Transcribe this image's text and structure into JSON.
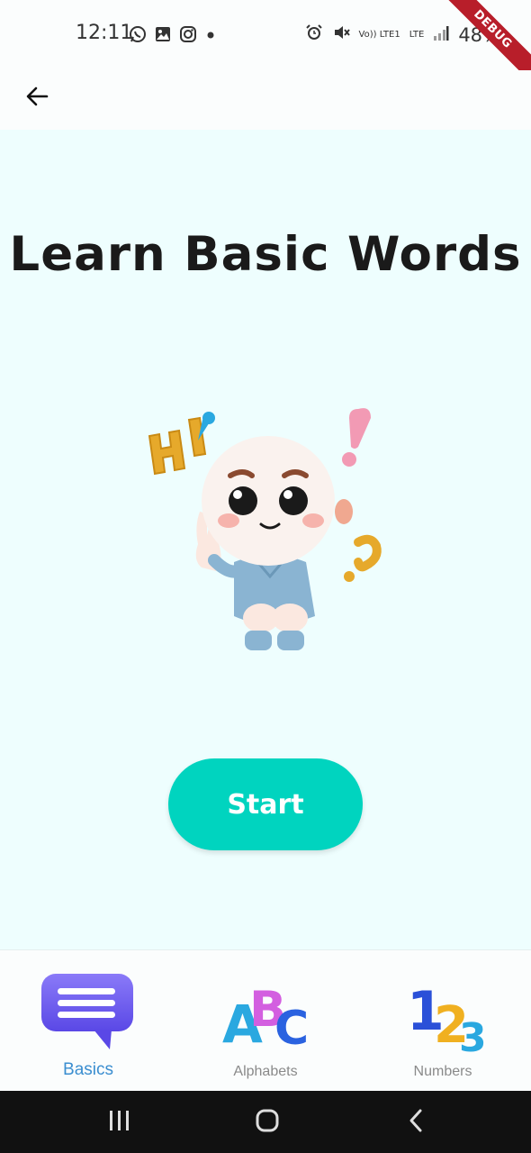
{
  "status_bar": {
    "time": "12:11",
    "battery": "48%",
    "volte": "Vo)) LTE1",
    "lte": "LTE",
    "icons": [
      "whatsapp-icon",
      "gallery-icon",
      "instagram-icon",
      "notification-dot-icon",
      "alarm-icon",
      "mute-icon",
      "signal-icon",
      "battery-icon"
    ]
  },
  "debug_banner": "DEBUG",
  "app_bar": {
    "back_icon": "arrow-left-icon"
  },
  "main": {
    "title": "Learn Basic Words",
    "illustration": "cartoon-child-hi-illustration",
    "start_button": "Start"
  },
  "bottom_nav": {
    "items": [
      {
        "label": "Basics",
        "icon": "speech-bubble-icon",
        "active": true
      },
      {
        "label": "Alphabets",
        "icon": "abc-blocks-icon",
        "active": false
      },
      {
        "label": "Numbers",
        "icon": "123-numbers-icon",
        "active": false
      }
    ]
  },
  "colors": {
    "background": "#eefefe",
    "accent": "#00d4bf",
    "active_tab": "#3b8ed0",
    "inactive_tab": "#8a8a8a",
    "title": "#1a1a1a"
  },
  "system_nav": {
    "icons": [
      "recents-icon",
      "home-icon",
      "back-icon"
    ]
  }
}
